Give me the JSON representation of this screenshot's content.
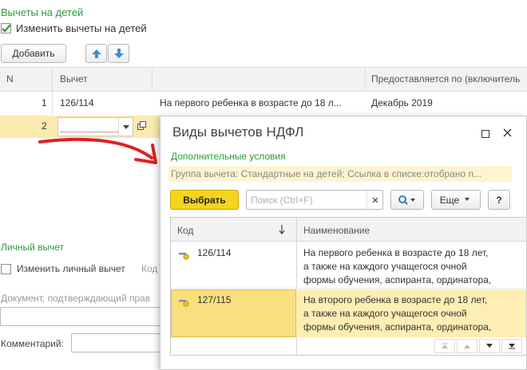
{
  "main": {
    "section_title": "Вычеты на детей",
    "change_checkbox_label": "Изменить вычеты на детей",
    "add_button": "Добавить",
    "table": {
      "columns": [
        "N",
        "Вычет",
        "",
        "Предоставляется по (включитель"
      ],
      "rows": [
        {
          "n": "1",
          "code": "126/114",
          "desc": "На первого ребенка в возрасте до 18 л...",
          "period": "Декабрь 2019"
        },
        {
          "n": "2",
          "code": "",
          "desc": "",
          "period": ""
        }
      ]
    },
    "personal_title": "Личный вычет",
    "personal_checkbox_label": "Изменить личный вычет",
    "personal_code_label": "Код",
    "document_label": "Документ, подтверждающий прав",
    "comment_label": "Комментарий:"
  },
  "popup": {
    "title": "Виды вычетов НДФЛ",
    "extra_conditions": "Дополнительные условия",
    "filter_text": "Группа вычета: Стандартные на детей; Ссылка в списке:отобрано п...",
    "select_button": "Выбрать",
    "search_placeholder": "Поиск (Ctrl+F)",
    "more_button": "Еще",
    "help_button": "?",
    "columns": {
      "code": "Код",
      "name": "Наименование"
    },
    "rows": [
      {
        "code": "126/114",
        "name_lines": [
          "На первого ребенка в возрасте до 18 лет,",
          "а также на каждого учащегося очной",
          "формы обучения, аспиранта, ординатора,"
        ]
      },
      {
        "code": "127/115",
        "name_lines": [
          "На второго ребенка в возрасте до 18 лет,",
          "а также на каждого учащегося очной",
          "формы обучения, аспиранта, ординатора,"
        ]
      }
    ]
  },
  "colors": {
    "accent_green": "#2e9a3a",
    "select_yellow": "#f6d41e",
    "row_highlight": "#fdeeb4",
    "arrow_red": "#e02020"
  }
}
